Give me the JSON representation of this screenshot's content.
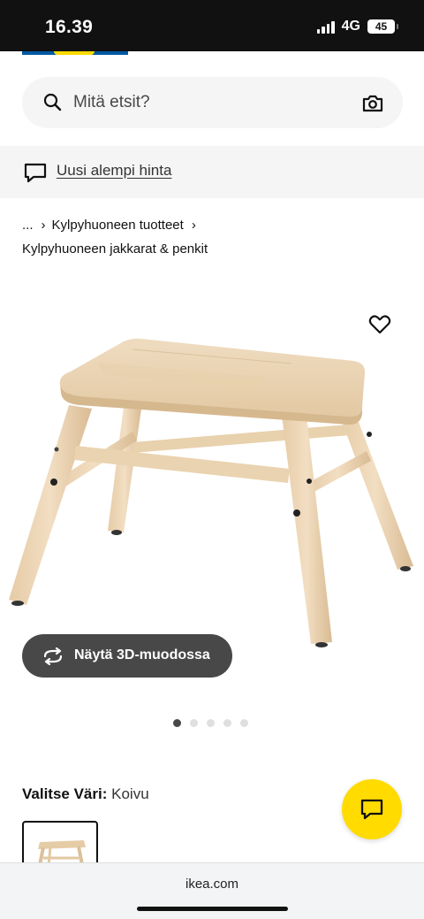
{
  "status_bar": {
    "time": "16.39",
    "network": "4G",
    "battery": "45"
  },
  "search": {
    "placeholder": "Mitä etsit?"
  },
  "promo": {
    "link_text": "Uusi alempi hinta"
  },
  "breadcrumb": {
    "ellipsis": "...",
    "items": [
      "Kylpyhuoneen tuotteet",
      "Kylpyhuoneen jakkarat & penkit"
    ]
  },
  "gallery": {
    "view_3d_label": "Näytä 3D-muodossa",
    "image_count": 5,
    "active_index": 0
  },
  "color_select": {
    "label": "Valitse Väri:",
    "value": "Koivu"
  },
  "browser": {
    "url": "ikea.com"
  },
  "colors": {
    "accent_yellow": "#ffdb00",
    "brand_blue": "#0058a3",
    "dark_button": "#484848",
    "wood": "#e9d2b0"
  }
}
